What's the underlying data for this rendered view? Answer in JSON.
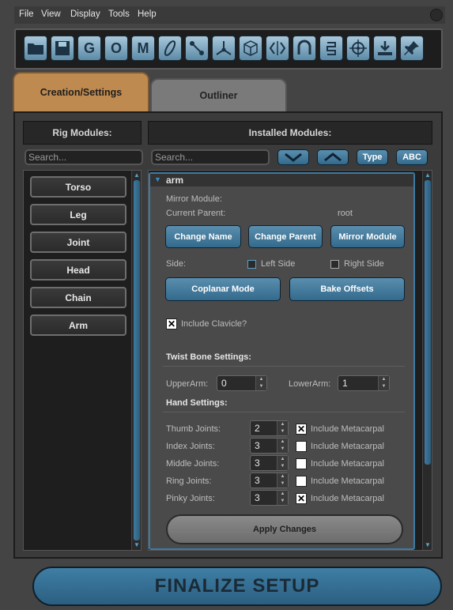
{
  "menu": {
    "items": [
      "File",
      "View",
      "Display",
      "Tools",
      "Help"
    ]
  },
  "toolbar": {
    "icons": [
      "folder-icon",
      "save-icon",
      "g-icon",
      "o-icon",
      "m-icon",
      "curve-icon",
      "bone-chain-icon",
      "axis-icon",
      "cube-icon",
      "mirror-icon",
      "magnet-icon",
      "spring-icon",
      "target-icon",
      "export-icon",
      "pin-icon"
    ]
  },
  "tabs": {
    "creation": "Creation/Settings",
    "outliner": "Outliner"
  },
  "left": {
    "header": "Rig Modules:",
    "search_placeholder": "Search...",
    "modules": [
      "Torso",
      "Leg",
      "Joint",
      "Head",
      "Chain",
      "Arm"
    ]
  },
  "right": {
    "header": "Installed Modules:",
    "search_placeholder": "Search...",
    "type_label": "Type",
    "abc_label": "ABC"
  },
  "arm": {
    "title": "arm",
    "mirror_module_label": "Mirror Module:",
    "current_parent_label": "Current Parent:",
    "current_parent_value": "root",
    "change_name": "Change Name",
    "change_parent": "Change Parent",
    "mirror_module_btn": "Mirror Module",
    "side_label": "Side:",
    "left_side": "Left Side",
    "right_side": "Right Side",
    "coplanar": "Coplanar Mode",
    "bake_offsets": "Bake Offsets",
    "include_clavicle": "Include Clavicle?",
    "include_clavicle_checked": true,
    "twist_header": "Twist Bone Settings:",
    "upper_arm_label": "UpperArm:",
    "upper_arm_value": "0",
    "lower_arm_label": "LowerArm:",
    "lower_arm_value": "1",
    "hand_header": "Hand Settings:",
    "fingers": [
      {
        "label": "Thumb Joints:",
        "value": "2",
        "metacarpal": "Include Metacarpal",
        "checked": true
      },
      {
        "label": "Index Joints:",
        "value": "3",
        "metacarpal": "Include Metacarpal",
        "checked": false
      },
      {
        "label": "Middle Joints:",
        "value": "3",
        "metacarpal": "Include Metacarpal",
        "checked": false
      },
      {
        "label": "Ring Joints:",
        "value": "3",
        "metacarpal": "Include Metacarpal",
        "checked": false
      },
      {
        "label": "Pinky Joints:",
        "value": "3",
        "metacarpal": "Include Metacarpal",
        "checked": true
      }
    ],
    "apply_changes": "Apply Changes"
  },
  "finalize": "FINALIZE SETUP"
}
